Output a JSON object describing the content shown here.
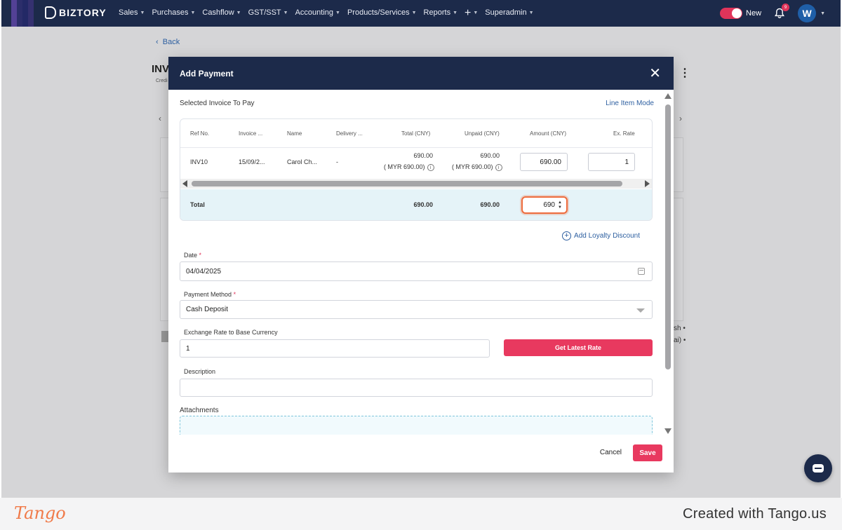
{
  "nav": {
    "logo": "BIZTORY",
    "items": [
      "Sales",
      "Purchases",
      "Cashflow",
      "GST/SST",
      "Accounting",
      "Products/Services",
      "Reports",
      "+",
      "Superadmin"
    ],
    "toggle_label": "New",
    "notification_count": "9",
    "avatar_initial": "W"
  },
  "background": {
    "back_label": "Back",
    "invoice_title": "INV",
    "invoice_sub": "Credi",
    "side_line1": "sh •",
    "side_line2": "ai) •"
  },
  "modal": {
    "title": "Add Payment",
    "selected_label": "Selected Invoice To Pay",
    "line_item_mode": "Line Item Mode",
    "table": {
      "headers": [
        "Ref No.",
        "Invoice ...",
        "Name",
        "Delivery ...",
        "Total (CNY)",
        "Unpaid (CNY)",
        "Amount (CNY)",
        "Ex. Rate"
      ],
      "row": {
        "ref": "INV10",
        "invoice_date": "15/09/2...",
        "name": "Carol Ch...",
        "delivery": "-",
        "total": "690.00",
        "total_base": "( MYR 690.00)",
        "unpaid": "690.00",
        "unpaid_base": "( MYR 690.00)",
        "amount": "690.00",
        "ex_rate": "1"
      },
      "total_row": {
        "label": "Total",
        "total": "690.00",
        "unpaid": "690.00",
        "amount_input": "690"
      }
    },
    "loyalty_label": "Add Loyalty Discount",
    "date": {
      "label": "Date",
      "value": "04/04/2025"
    },
    "payment_method": {
      "label": "Payment Method",
      "value": "Cash Deposit"
    },
    "exchange_rate": {
      "label": "Exchange Rate to Base Currency",
      "value": "1",
      "button": "Get Latest Rate"
    },
    "description": {
      "label": "Description",
      "value": ""
    },
    "attachments_label": "Attachments",
    "required_mark": "*",
    "cancel_label": "Cancel",
    "save_label": "Save"
  },
  "tango": {
    "logo": "Tango",
    "credit": "Created with Tango.us"
  },
  "colors": {
    "nav_bg": "#1c2a4a",
    "accent": "#e8395f",
    "link": "#2d5fa0",
    "focus": "#ee6b3c",
    "total_row_bg": "#e5f3f8"
  }
}
